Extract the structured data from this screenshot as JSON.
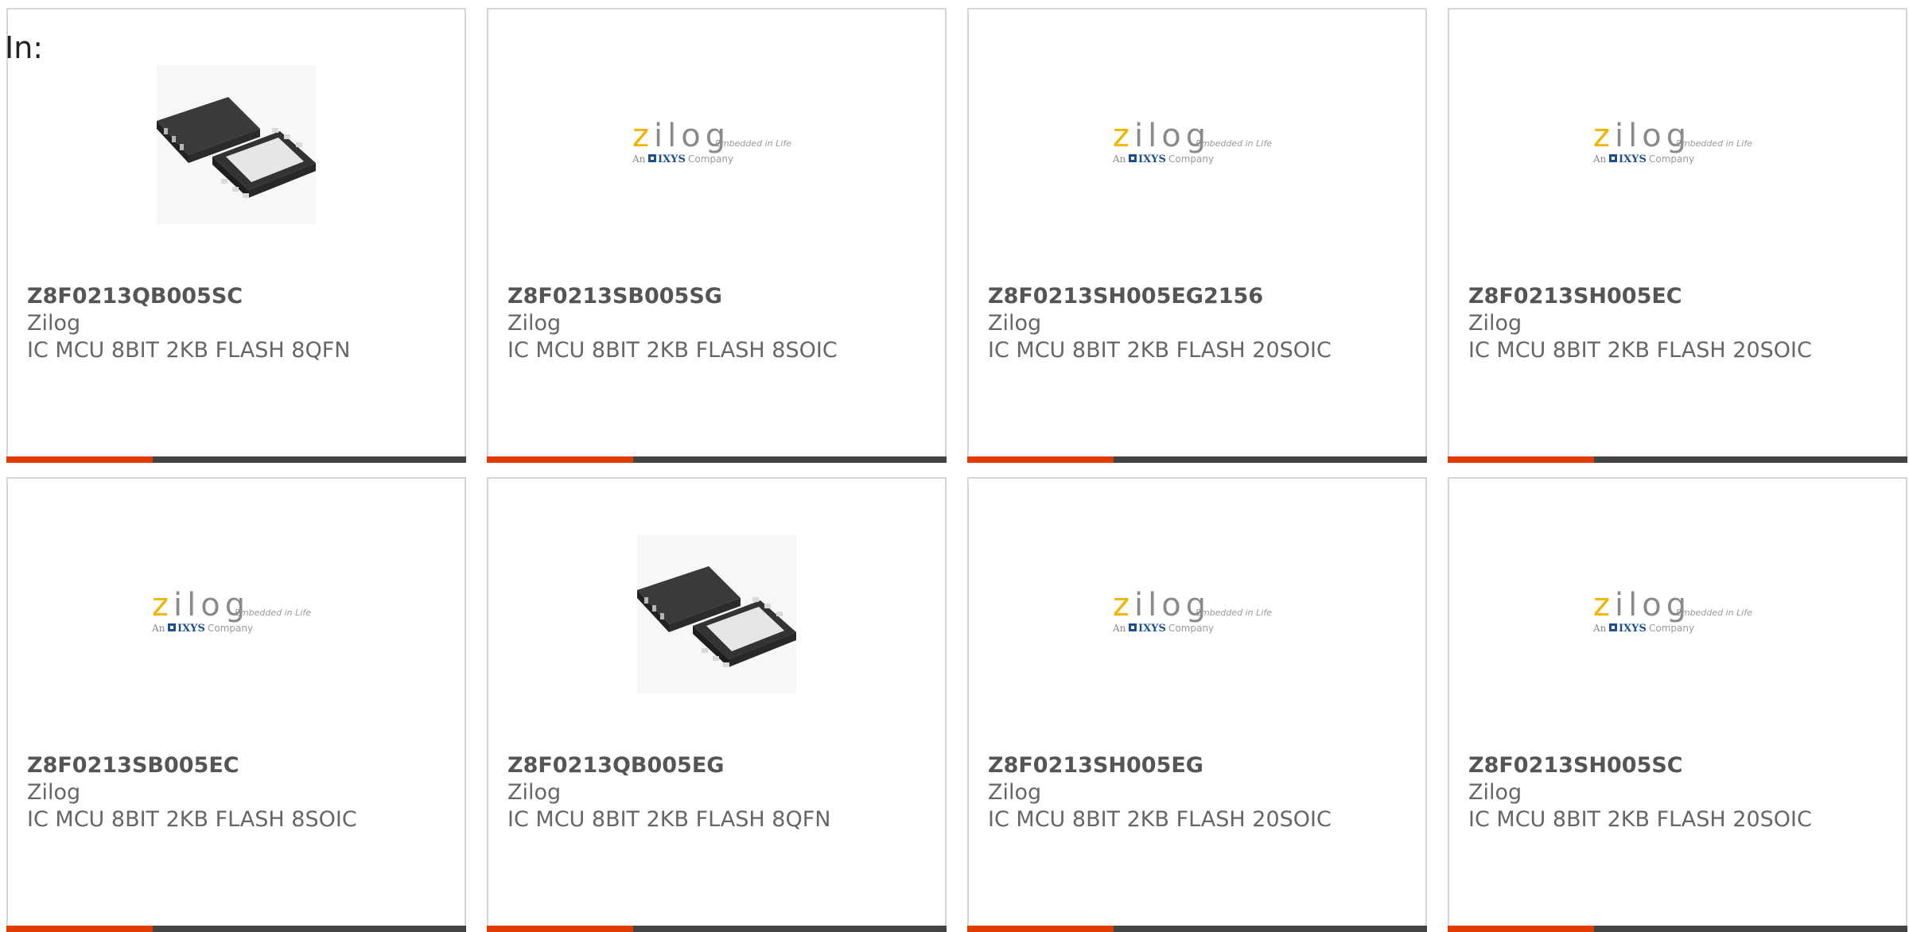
{
  "filter": {
    "label": "In:"
  },
  "logo": {
    "wordmark": "zilog",
    "tagline": "Embedded in Life",
    "an": "An",
    "ixys": "IXYS",
    "company": "Company"
  },
  "colors": {
    "accent_orange": "#e03c00",
    "accent_dark": "#444444",
    "zilog_yellow": "#f2b400",
    "ixys_blue": "#1f4f8f"
  },
  "products": [
    {
      "part_number": "Z8F0213QB005SC",
      "manufacturer": "Zilog",
      "description": "IC MCU 8BIT 2KB FLASH 8QFN",
      "image": "qfn-chip-image"
    },
    {
      "part_number": "Z8F0213SB005SG",
      "manufacturer": "Zilog",
      "description": "IC MCU 8BIT 2KB FLASH 8SOIC",
      "image": "zilog-logo"
    },
    {
      "part_number": "Z8F0213SH005EG2156",
      "manufacturer": "Zilog",
      "description": "IC MCU 8BIT 2KB FLASH 20SOIC",
      "image": "zilog-logo"
    },
    {
      "part_number": "Z8F0213SH005EC",
      "manufacturer": "Zilog",
      "description": "IC MCU 8BIT 2KB FLASH 20SOIC",
      "image": "zilog-logo"
    },
    {
      "part_number": "Z8F0213SB005EC",
      "manufacturer": "Zilog",
      "description": "IC MCU 8BIT 2KB FLASH 8SOIC",
      "image": "zilog-logo"
    },
    {
      "part_number": "Z8F0213QB005EG",
      "manufacturer": "Zilog",
      "description": "IC MCU 8BIT 2KB FLASH 8QFN",
      "image": "qfn-chip-image"
    },
    {
      "part_number": "Z8F0213SH005EG",
      "manufacturer": "Zilog",
      "description": "IC MCU 8BIT 2KB FLASH 20SOIC",
      "image": "zilog-logo"
    },
    {
      "part_number": "Z8F0213SH005SC",
      "manufacturer": "Zilog",
      "description": "IC MCU 8BIT 2KB FLASH 20SOIC",
      "image": "zilog-logo"
    }
  ]
}
